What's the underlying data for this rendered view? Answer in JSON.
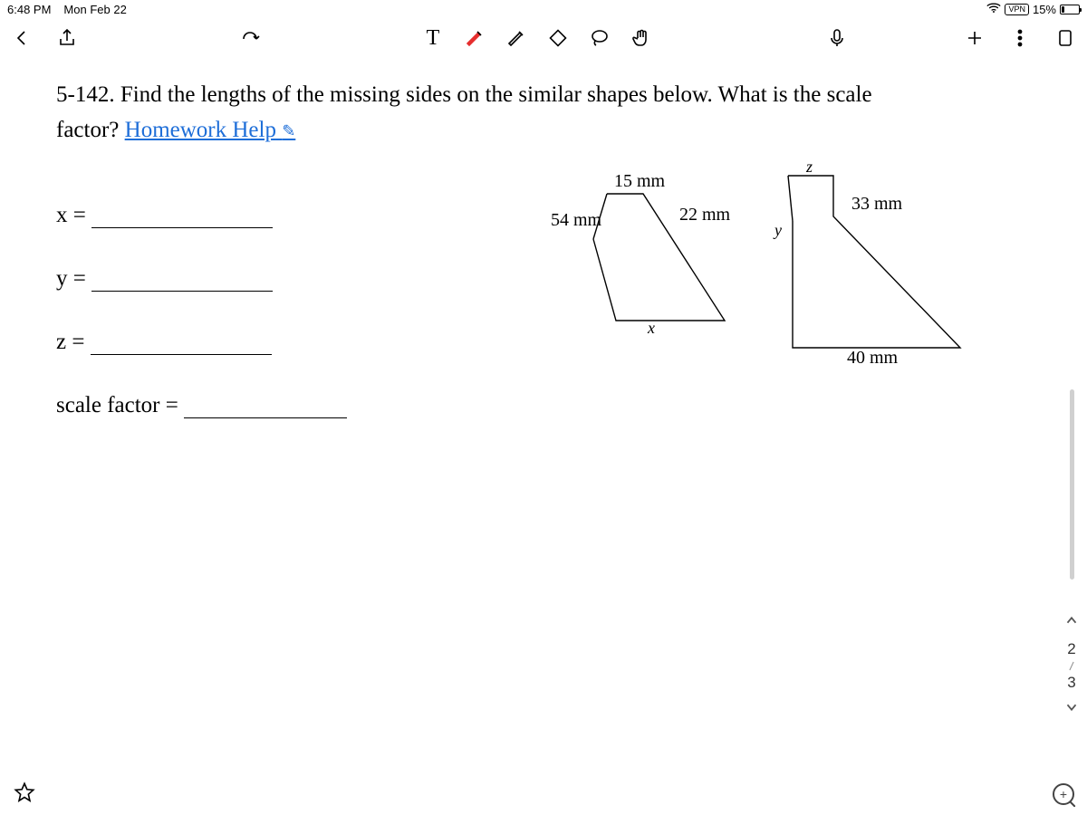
{
  "status": {
    "time": "6:48 PM",
    "date": "Mon Feb 22",
    "vpn_label": "VPN",
    "battery_pct": "15%"
  },
  "toolbar": {
    "text_tool": "T"
  },
  "problem": {
    "number": "5-142.",
    "prompt_a": "Find the lengths of the missing sides on the similar shapes below.  What is the scale",
    "prompt_b": "factor?",
    "help_link": "Homework Help"
  },
  "answers": {
    "x_label": "x = ",
    "y_label": "y = ",
    "z_label": "z = ",
    "sf_label": "scale factor = "
  },
  "figure": {
    "small": {
      "top": "15 mm",
      "left": "54 mm",
      "right": "22 mm",
      "bottom_var": "x"
    },
    "large": {
      "top_var": "z",
      "right": "33 mm",
      "left_var": "y",
      "bottom": "40 mm"
    }
  },
  "rail": {
    "current": "2",
    "total": "3"
  }
}
